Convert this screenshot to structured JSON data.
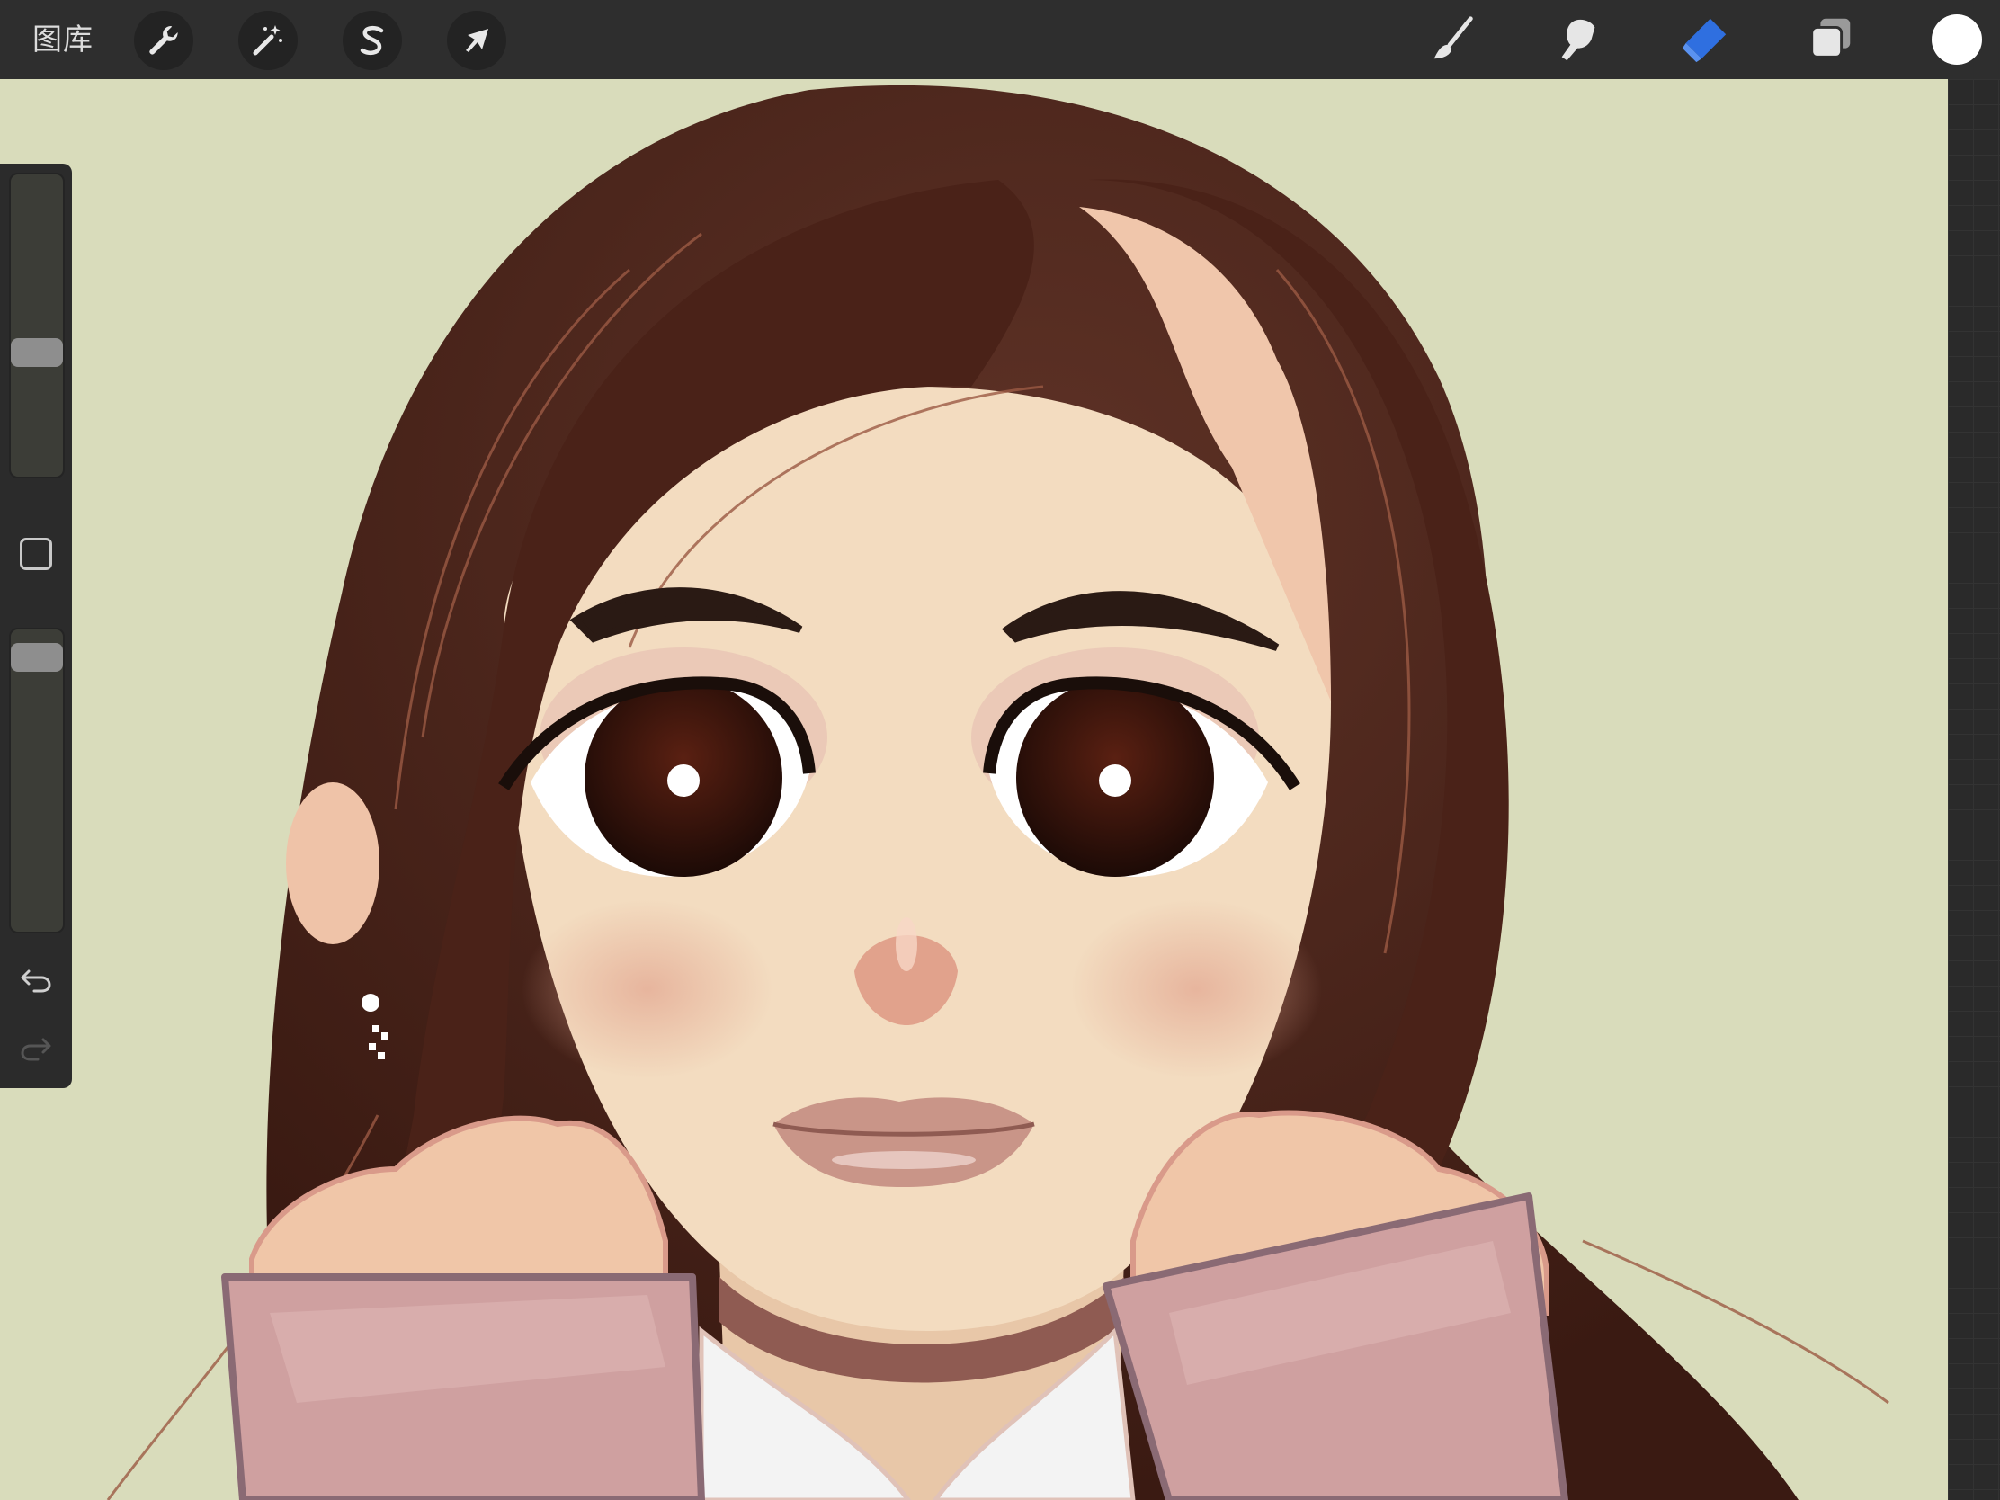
{
  "toolbar": {
    "gallery_label": "图库",
    "left_tools": [
      {
        "name": "actions",
        "icon": "wrench-icon"
      },
      {
        "name": "adjustments",
        "icon": "magic-wand-icon"
      },
      {
        "name": "selection",
        "icon": "selection-s-icon"
      },
      {
        "name": "transform",
        "icon": "arrow-cursor-icon"
      }
    ],
    "right_tools": [
      {
        "name": "brush",
        "icon": "brush-icon",
        "active": false
      },
      {
        "name": "smudge",
        "icon": "smudge-icon",
        "active": false
      },
      {
        "name": "eraser",
        "icon": "eraser-icon",
        "active": true
      },
      {
        "name": "layers",
        "icon": "layers-icon",
        "active": false
      }
    ],
    "current_color": "#ffffff",
    "active_tool_color": "#2f6fe0"
  },
  "sidebar": {
    "brush_size_level": 0.4,
    "opacity_level": 0.95,
    "modify_icon": "square-modify-icon",
    "undo_icon": "undo-arrow-icon",
    "redo_icon": "redo-arrow-icon"
  },
  "canvas": {
    "background_color": "#d9dcbb",
    "artwork": "illustration-girl-portrait"
  }
}
